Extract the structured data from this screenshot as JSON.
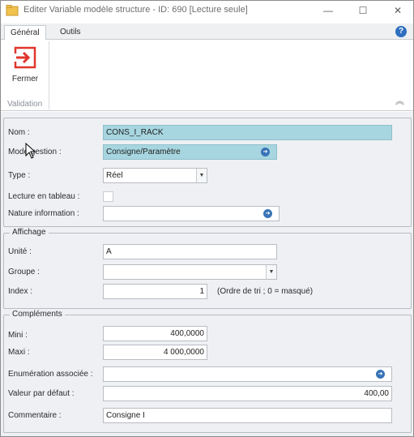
{
  "window": {
    "title": "Editer Variable modèle structure - ID: 690  [Lecture seule]",
    "minimize_glyph": "—",
    "maximize_glyph": "☐",
    "close_glyph": "✕"
  },
  "ribbon": {
    "tabs": [
      {
        "label": "Général",
        "active": true
      },
      {
        "label": "Outils",
        "active": false
      }
    ],
    "help_glyph": "?",
    "close_button_label": "Fermer",
    "group_label": "Validation",
    "collapse_glyph": "︽"
  },
  "general": {
    "nom_label": "Nom :",
    "nom_value": "CONS_I_RACK",
    "mode_gestion_label": "Mode gestion :",
    "mode_gestion_value": "Consigne/Paramètre",
    "type_label": "Type :",
    "type_value": "Réel",
    "lecture_tableau_label": "Lecture en tableau :",
    "nature_info_label": "Nature information :",
    "nature_info_value": ""
  },
  "affichage": {
    "title": "Affichage",
    "unite_label": "Unité :",
    "unite_value": "A",
    "groupe_label": "Groupe :",
    "groupe_value": "",
    "index_label": "Index :",
    "index_value": "1",
    "index_hint": "(Ordre de tri ; 0 = masqué)"
  },
  "complements": {
    "title": "Compléments",
    "mini_label": "Mini :",
    "mini_value": "400,0000",
    "maxi_label": "Maxi :",
    "maxi_value": "4 000,0000",
    "enum_label": "Enumération associée :",
    "enum_value": "",
    "defaut_label": "Valeur par défaut :",
    "defaut_value": "400,00",
    "commentaire_label": "Commentaire :",
    "commentaire_value": "Consigne I"
  },
  "colors": {
    "highlight": "#a7d6e0",
    "accent_red": "#e0352b",
    "link_blue": "#3974b8"
  }
}
